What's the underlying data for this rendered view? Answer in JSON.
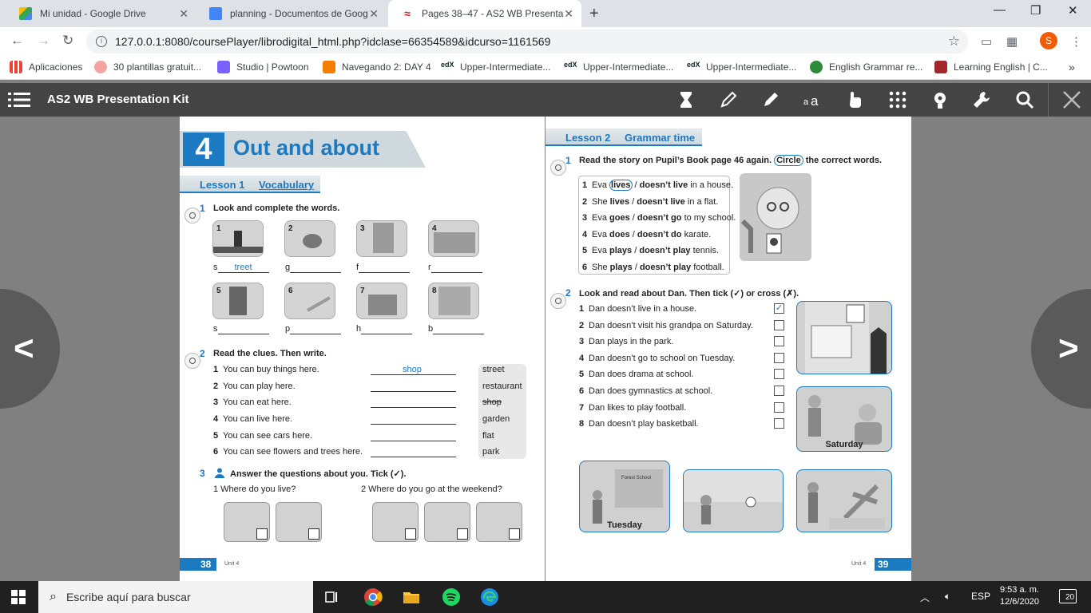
{
  "browser": {
    "tabs": [
      {
        "title": "Mi unidad - Google Drive",
        "icon": "google-drive-icon"
      },
      {
        "title": "planning - Documentos de Goog",
        "icon": "google-docs-icon"
      },
      {
        "title": "Pages 38–47 - AS2 WB Presentat",
        "icon": "macmillan-icon"
      }
    ],
    "url": "127.0.0.1:8080/coursePlayer/librodigital_html.php?idclase=66354589&idcurso=1161569",
    "avatar_letter": "S",
    "bookmarks": [
      "Aplicaciones",
      "30 plantillas gratuit...",
      "Studio | Powtoon",
      "Navegando 2: DAY 4",
      "Upper-Intermediate...",
      "Upper-Intermediate...",
      "Upper-Intermediate...",
      "English Grammar re...",
      "Learning English | C..."
    ]
  },
  "app": {
    "title": "AS2 WB Presentation Kit"
  },
  "left_page": {
    "unit_number": "4",
    "unit_title": "Out and about",
    "lesson_label": "Lesson 1",
    "lesson_topic": "Vocabulary",
    "ex1": {
      "number": "1",
      "instruction": "Look and complete the words.",
      "row1": [
        {
          "num": "1",
          "prefix": "s",
          "answer": "treet"
        },
        {
          "num": "2",
          "prefix": "g",
          "answer": ""
        },
        {
          "num": "3",
          "prefix": "f",
          "answer": ""
        },
        {
          "num": "4",
          "prefix": "r",
          "answer": ""
        }
      ],
      "row2": [
        {
          "num": "5",
          "prefix": "s",
          "answer": ""
        },
        {
          "num": "6",
          "prefix": "p",
          "answer": ""
        },
        {
          "num": "7",
          "prefix": "h",
          "answer": ""
        },
        {
          "num": "8",
          "prefix": "b",
          "answer": ""
        }
      ]
    },
    "ex2": {
      "number": "2",
      "instruction": "Read the clues. Then write.",
      "items": [
        {
          "n": "1",
          "text": "You can buy things here.",
          "answer": "shop"
        },
        {
          "n": "2",
          "text": "You can play here.",
          "answer": ""
        },
        {
          "n": "3",
          "text": "You can eat here.",
          "answer": ""
        },
        {
          "n": "4",
          "text": "You can live here.",
          "answer": ""
        },
        {
          "n": "5",
          "text": "You can see cars here.",
          "answer": ""
        },
        {
          "n": "6",
          "text": "You can see flowers and trees here.",
          "answer": ""
        }
      ],
      "words": [
        "street",
        "restaurant",
        "shop",
        "garden",
        "flat",
        "park"
      ]
    },
    "ex3": {
      "number": "3",
      "instruction": "Answer the questions about you. Tick (✓).",
      "q1": "1  Where do you live?",
      "q2": "2  Where do you go at the weekend?"
    },
    "page_number": "38",
    "footer": "Unit 4"
  },
  "right_page": {
    "lesson_label": "Lesson 2",
    "lesson_topic": "Grammar time",
    "ex1": {
      "number": "1",
      "instruction_a": "Read the story on Pupil’s Book page 46 again.",
      "instruction_circle": "Circle",
      "instruction_b": "the correct words.",
      "items": [
        {
          "n": "1",
          "pre": "Eva",
          "a": "lives",
          "b": "doesn’t live",
          "post": "in a house."
        },
        {
          "n": "2",
          "pre": "She",
          "a": "lives",
          "b": "doesn’t live",
          "post": "in a flat."
        },
        {
          "n": "3",
          "pre": "Eva",
          "a": "goes",
          "b": "doesn’t go",
          "post": "to my school."
        },
        {
          "n": "4",
          "pre": "Eva",
          "a": "does",
          "b": "doesn’t do",
          "post": "karate."
        },
        {
          "n": "5",
          "pre": "Eva",
          "a": "plays",
          "b": "doesn’t play",
          "post": "tennis."
        },
        {
          "n": "6",
          "pre": "She",
          "a": "plays",
          "b": "doesn’t play",
          "post": "football."
        }
      ]
    },
    "ex2": {
      "number": "2",
      "instruction": "Look and read about Dan. Then tick (✓) or cross (✗).",
      "items": [
        {
          "n": "1",
          "text": "Dan doesn’t live in a house.",
          "mark": "✓"
        },
        {
          "n": "2",
          "text": "Dan doesn’t visit his grandpa on Saturday.",
          "mark": ""
        },
        {
          "n": "3",
          "text": "Dan plays in the park.",
          "mark": ""
        },
        {
          "n": "4",
          "text": "Dan doesn’t go to school on Tuesday.",
          "mark": ""
        },
        {
          "n": "5",
          "text": "Dan does drama at school.",
          "mark": ""
        },
        {
          "n": "6",
          "text": "Dan does gymnastics at school.",
          "mark": ""
        },
        {
          "n": "7",
          "text": "Dan likes to play football.",
          "mark": ""
        },
        {
          "n": "8",
          "text": "Dan doesn’t play basketball.",
          "mark": ""
        }
      ],
      "captions": {
        "saturday": "Saturday",
        "tuesday": "Tuesday"
      }
    },
    "page_number": "39",
    "footer": "Unit 4"
  },
  "taskbar": {
    "search_placeholder": "Escribe aquí para buscar",
    "language": "ESP",
    "time": "9:53 a. m.",
    "date": "12/6/2020",
    "notifications": "20"
  },
  "colors": {
    "accent": "#1c7ac2",
    "appbar": "#444444",
    "viewer_bg": "#808080"
  }
}
